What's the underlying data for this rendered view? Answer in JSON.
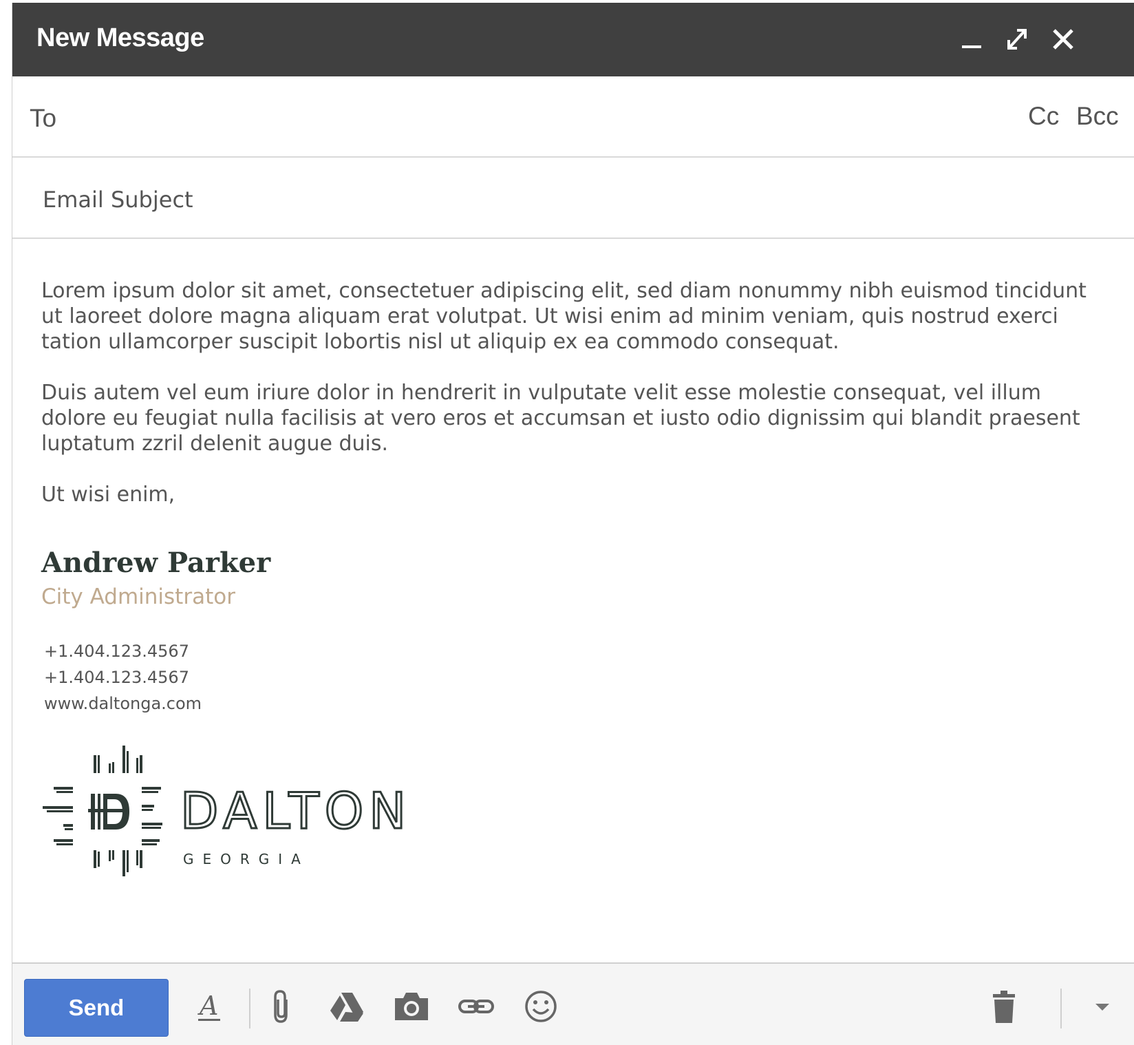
{
  "window": {
    "title": "New Message",
    "minimize_icon": "minimize-icon",
    "expand_icon": "expand-icon",
    "close_icon": "close-icon"
  },
  "recipients": {
    "to_label": "To",
    "to_value": "",
    "cc_label": "Cc",
    "bcc_label": "Bcc"
  },
  "subject": {
    "placeholder": "Email Subject",
    "value": ""
  },
  "body": {
    "paragraphs": [
      "Lorem ipsum dolor sit amet, consectetuer adipiscing elit, sed diam nonummy nibh euismod tincidunt ut laoreet dolore magna aliquam erat volutpat. Ut wisi enim ad minim veniam, quis nostrud exerci tation ullamcorper suscipit lobortis nisl ut aliquip ex ea commodo consequat.",
      "Duis autem vel eum iriure dolor in hendrerit in vulputate velit esse molestie consequat, vel illum dolore eu feugiat nulla facilisis at vero eros et accumsan et iusto odio dignissim qui blandit praesent luptatum zzril delenit augue duis.",
      "Ut wisi enim,"
    ]
  },
  "signature": {
    "name": "Andrew Parker",
    "title": "City Administrator",
    "phone_1": "+1.404.123.4567",
    "phone_2": "+1.404.123.4567",
    "website": "www.daltonga.com",
    "logo": {
      "wordmark": "DALTON",
      "subtext": "GEORGIA",
      "color": "#2f3a36"
    },
    "title_color": "#c0aa8f"
  },
  "toolbar": {
    "send_label": "Send",
    "send_color": "#4d7cd2",
    "icons": [
      "text-formatting-icon",
      "attach-file-icon",
      "google-drive-icon",
      "insert-photo-icon",
      "insert-link-icon",
      "insert-emoji-icon",
      "discard-trash-icon",
      "more-options-icon"
    ]
  }
}
